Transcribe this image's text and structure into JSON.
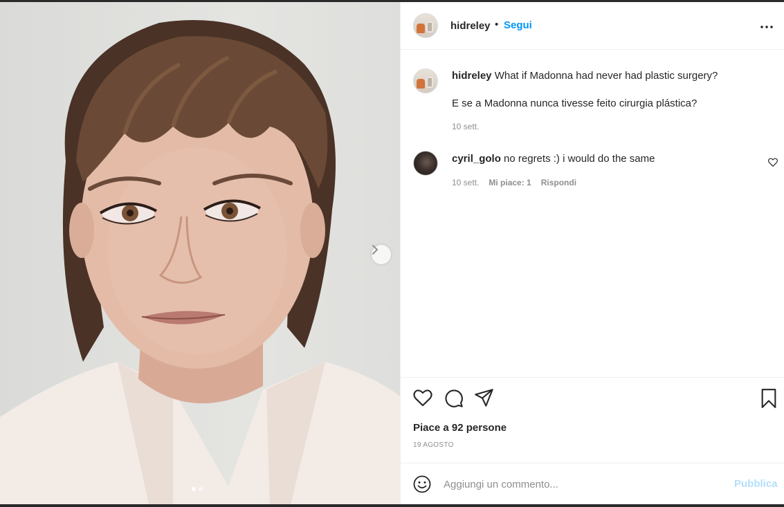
{
  "post": {
    "username": "hidreley",
    "separator": "•",
    "follow_label": "Segui",
    "more_icon": "more-horizontal-icon",
    "more_label": "•••"
  },
  "caption": {
    "username": "hidreley",
    "text": "What if Madonna had never had plastic surgery?",
    "text_translation": "E se a Madonna nunca tivesse feito cirurgia plástica?",
    "time": "10 sett."
  },
  "comments": [
    {
      "username": "cyril_golo",
      "text": "no regrets :) i would do the same",
      "time": "10 sett.",
      "likes": "Mi piace: 1",
      "reply_label": "Rispondi"
    }
  ],
  "actions": {
    "icons": [
      "heart-icon",
      "comment-icon",
      "share-icon",
      "bookmark-icon"
    ],
    "likes_text": "Piace a 92 persone",
    "date": "19 AGOSTO"
  },
  "comment_box": {
    "placeholder": "Aggiungi un commento...",
    "publish_label": "Pubblica"
  },
  "carousel": {
    "current": 1,
    "total": 2
  },
  "colors": {
    "accent": "#0095f6",
    "publish_disabled": "#b2dffc",
    "muted": "#8e8e8e",
    "text": "#262626"
  }
}
